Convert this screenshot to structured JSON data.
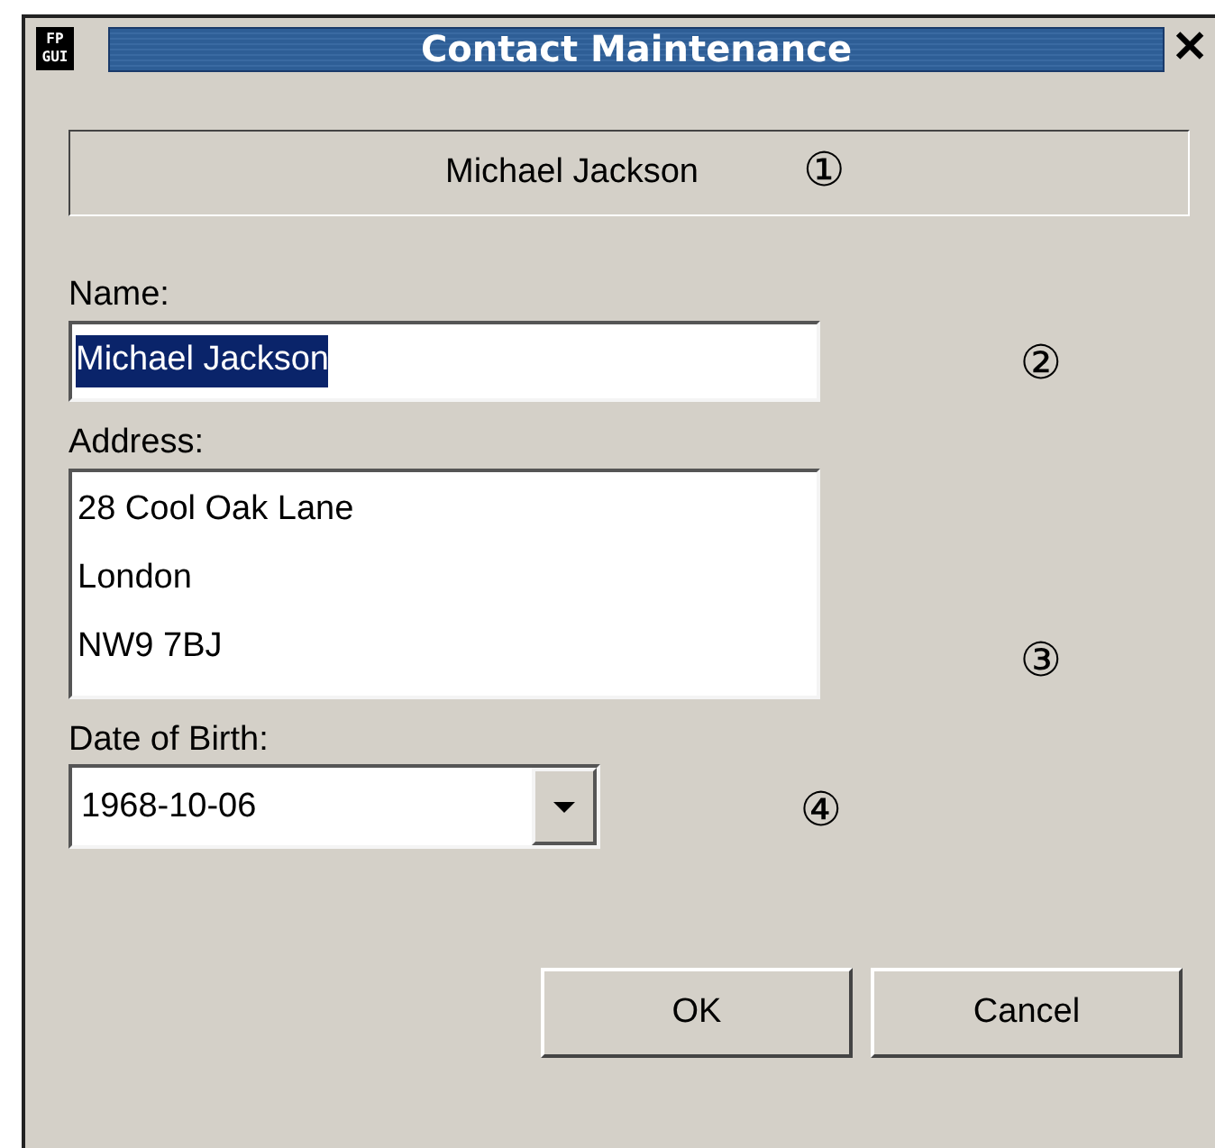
{
  "window": {
    "title": "Contact Maintenance",
    "app_icon": "FP GUI",
    "close": "✕"
  },
  "header": {
    "text": "Michael Jackson",
    "marker": "①"
  },
  "fields": [
    {
      "kind": "text",
      "label": "Name:",
      "value": "Michael Jackson",
      "text_selected": true,
      "marker": "②"
    },
    {
      "kind": "memo",
      "label": "Address:",
      "lines": [
        "28 Cool Oak Lane",
        "London",
        "NW9 7BJ"
      ],
      "marker": "③"
    },
    {
      "kind": "combo",
      "label": "Date of Birth:",
      "value": "1968-10-06",
      "marker": "④"
    }
  ],
  "buttons": [
    "OK",
    "Cancel"
  ]
}
